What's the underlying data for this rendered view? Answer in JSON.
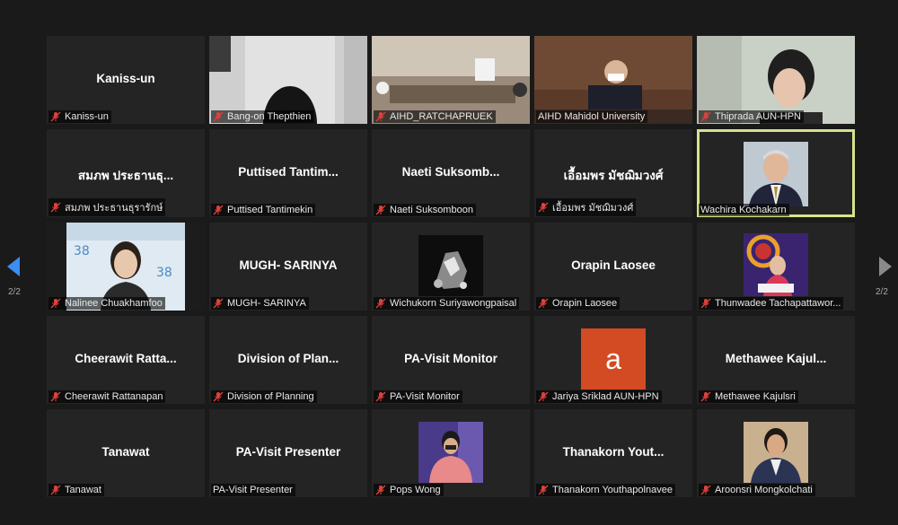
{
  "nav": {
    "left_page": "2/2",
    "right_page": "2/2"
  },
  "colors": {
    "active_border": "#d7e38a",
    "muted_mic": "#e0413a",
    "letter_avatar_bg": "#d24b23"
  },
  "avatar_letter": "a",
  "tiles": [
    {
      "display": "Kaniss-un",
      "label": "Kaniss-un",
      "muted": true
    },
    {
      "display": "",
      "label": "Bang-on Thepthien",
      "muted": true
    },
    {
      "display": "",
      "label": "AIHD_RATCHAPRUEK",
      "muted": true
    },
    {
      "display": "",
      "label": "AIHD Mahidol University",
      "muted": false
    },
    {
      "display": "",
      "label": "Thiprada AUN-HPN",
      "muted": true
    },
    {
      "display": "สมภพ ประธานธุ...",
      "label": "สมภพ ประธานธุรารักษ์",
      "muted": true
    },
    {
      "display": "Puttised Tantim...",
      "label": "Puttised Tantimekin",
      "muted": true
    },
    {
      "display": "Naeti Suksomb...",
      "label": "Naeti Suksomboon",
      "muted": true
    },
    {
      "display": "เอื้อมพร มัชฌิมวงศ์",
      "label": "เอื้อมพร มัชฌิมวงศ์",
      "muted": true
    },
    {
      "display": "",
      "label": "Wachira Kochakarn",
      "muted": false
    },
    {
      "display": "",
      "label": "Nalinee Chuakhamfoo",
      "muted": true
    },
    {
      "display": "MUGH- SARINYA",
      "label": "MUGH- SARINYA",
      "muted": true
    },
    {
      "display": "",
      "label": "Wichukorn Suriyawongpaisal",
      "muted": true
    },
    {
      "display": "Orapin Laosee",
      "label": "Orapin Laosee",
      "muted": true
    },
    {
      "display": "",
      "label": "Thunwadee Tachapattawor...",
      "muted": true
    },
    {
      "display": "Cheerawit Ratta...",
      "label": "Cheerawit Rattanapan",
      "muted": true
    },
    {
      "display": "Division of Plan...",
      "label": "Division of Planning",
      "muted": true
    },
    {
      "display": "PA-Visit Monitor",
      "label": "PA-Visit Monitor",
      "muted": true
    },
    {
      "display": "",
      "label": "Jariya Sriklad AUN-HPN",
      "muted": true
    },
    {
      "display": "Methawee Kajul...",
      "label": "Methawee Kajulsri",
      "muted": true
    },
    {
      "display": "Tanawat",
      "label": "Tanawat",
      "muted": true
    },
    {
      "display": "PA-Visit Presenter",
      "label": "PA-Visit Presenter",
      "muted": false
    },
    {
      "display": "",
      "label": "Pops Wong",
      "muted": true
    },
    {
      "display": "Thanakorn Yout...",
      "label": "Thanakorn Youthapolnavee",
      "muted": true
    },
    {
      "display": "",
      "label": "Aroonsri Mongkolchati",
      "muted": true
    }
  ]
}
